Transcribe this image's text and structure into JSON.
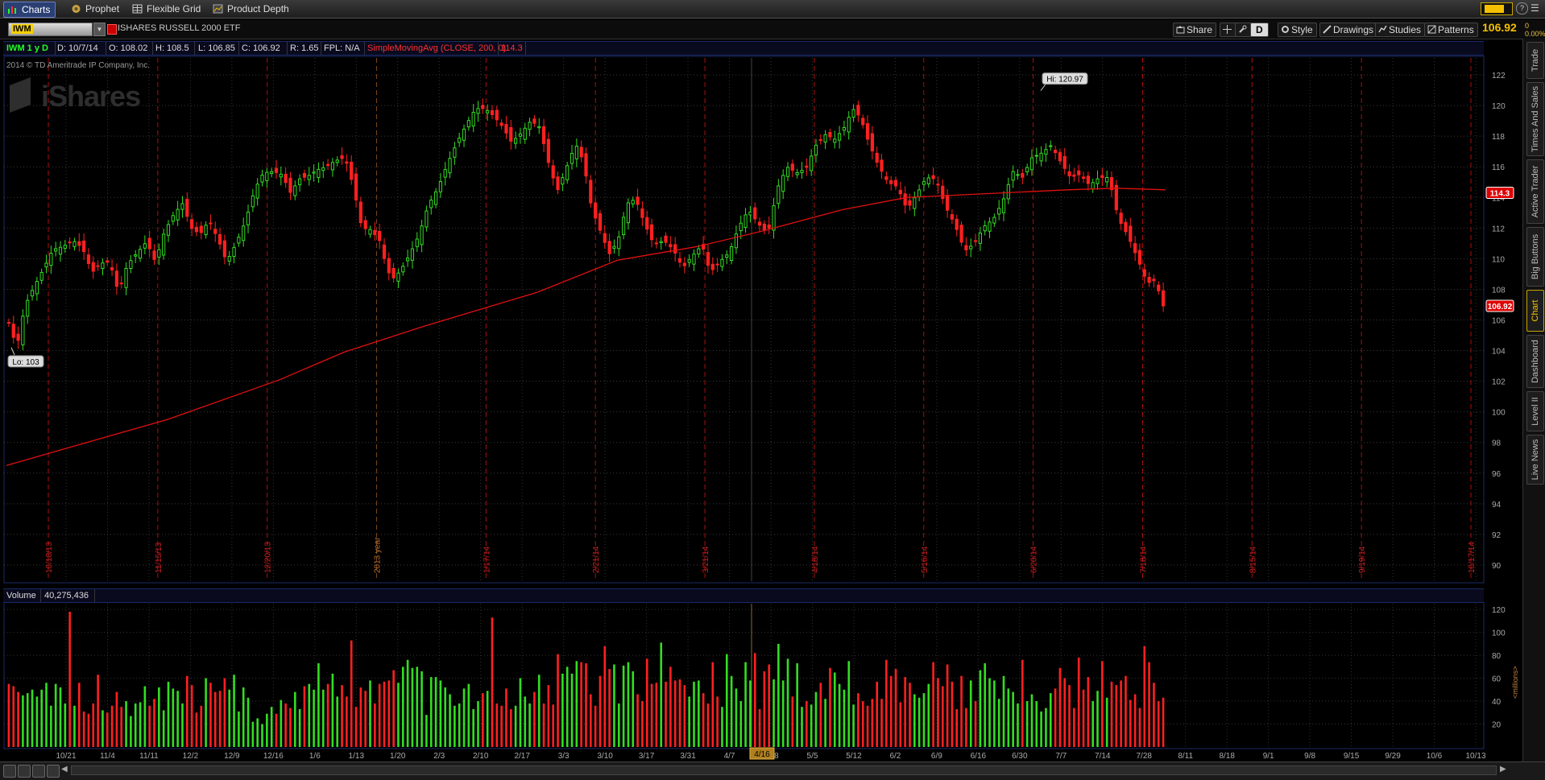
{
  "topbar": {
    "tabs": [
      {
        "label": "Charts",
        "icon": "charts-icon",
        "active": true
      },
      {
        "label": "Prophet",
        "icon": "prophet-icon",
        "active": false
      },
      {
        "label": "Flexible Grid",
        "icon": "grid-icon",
        "active": false
      },
      {
        "label": "Product Depth",
        "icon": "depth-icon",
        "active": false
      }
    ]
  },
  "header": {
    "symbol": "IWM",
    "name": "ISHARES RUSSELL 2000 ETF",
    "last_price": "106.92",
    "change_a": "0",
    "change_b": "0.00%"
  },
  "toolbar": {
    "share": "Share",
    "period": "D",
    "style": "Style",
    "drawings": "Drawings",
    "studies": "Studies",
    "patterns": "Patterns"
  },
  "ohlc": {
    "period": "IWM 1 y D",
    "date": "D: 10/7/14",
    "open": "O: 108.02",
    "high": "H: 108.5",
    "low": "L: 106.85",
    "close": "C: 106.92",
    "range": "R: 1.65",
    "fpl": "FPL: N/A",
    "study": "SimpleMovingAvg (CLOSE, 200, 0)",
    "study_value": "114.3"
  },
  "watermark": {
    "copyright": "2014 © TD Ameritrade IP Company, Inc.",
    "logo": "iShares"
  },
  "volume": {
    "label": "Volume",
    "value": "40,275,436",
    "unit_label": "<millions>"
  },
  "sidebar": {
    "tabs": [
      "Trade",
      "Times And Sales",
      "Active Trader",
      "Big Buttons",
      "Chart",
      "Dashboard",
      "Level II",
      "Live News"
    ],
    "active": "Chart"
  },
  "colors": {
    "up": "#33dd22",
    "down": "#ff2020",
    "sma": "#e01010",
    "price_tag": "#dd0000",
    "accent": "#f5c000"
  },
  "chart_data": [
    {
      "type": "candlestick",
      "title": "",
      "xlabel": "",
      "ylabel": "",
      "ylim": [
        89,
        123
      ],
      "yticks": [
        90,
        92,
        94,
        96,
        98,
        100,
        102,
        104,
        106,
        108,
        110,
        112,
        114,
        116,
        118,
        120,
        122
      ],
      "x_tick_labels": [
        "10/21",
        "11/4",
        "11/11",
        "12/2",
        "12/9",
        "12/16",
        "1/6",
        "1/13",
        "1/20",
        "2/3",
        "2/10",
        "2/17",
        "3/3",
        "3/10",
        "3/17",
        "3/31",
        "4/7",
        "4/28",
        "5/5",
        "5/12",
        "6/2",
        "6/9",
        "6/16",
        "6/30",
        "7/7",
        "7/14",
        "7/28",
        "8/11",
        "8/18",
        "9/1",
        "9/8",
        "9/15",
        "9/29",
        "10/6",
        "10/13"
      ],
      "event_labels": [
        "10/18/13",
        "11/15/13",
        "12/20/13",
        "2013 year",
        "1/17/14",
        "2/21/14",
        "3/21/14",
        "4/18/14",
        "5/16/14",
        "6/20/14",
        "7/18/14",
        "8/15/14",
        "9/19/14",
        "10/17/14"
      ],
      "cursor_label": "4/16",
      "hi_label": "Hi: 120.97",
      "lo_label": "Lo: 103",
      "sma_label": "114.3",
      "last_label": "106.92",
      "series": [
        {
          "name": "SimpleMovingAvg (CLOSE, 200, 0)",
          "points": [
            [
              0,
              96.5
            ],
            [
              80,
              97.7
            ],
            [
              200,
              99.5
            ],
            [
              340,
              102.1
            ],
            [
              420,
              103.9
            ],
            [
              520,
              105.6
            ],
            [
              660,
              107.8
            ],
            [
              760,
              109.9
            ],
            [
              860,
              110.8
            ],
            [
              940,
              111.8
            ],
            [
              1040,
              113.2
            ],
            [
              1120,
              114.0
            ],
            [
              1200,
              114.2
            ],
            [
              1320,
              114.5
            ],
            [
              1380,
              114.6
            ],
            [
              1442,
              114.5
            ]
          ]
        }
      ],
      "ohlc_path": [
        [
          0,
          105.8
        ],
        [
          10,
          104.2
        ],
        [
          20,
          106.9
        ],
        [
          30,
          108.0
        ],
        [
          45,
          109.5
        ],
        [
          55,
          110.6
        ],
        [
          68,
          110.8
        ],
        [
          80,
          111.2
        ],
        [
          92,
          110.7
        ],
        [
          104,
          109.1
        ],
        [
          115,
          109.7
        ],
        [
          126,
          109.8
        ],
        [
          137,
          107.8
        ],
        [
          148,
          109.6
        ],
        [
          159,
          110.3
        ],
        [
          172,
          111.1
        ],
        [
          183,
          109.8
        ],
        [
          194,
          111.7
        ],
        [
          206,
          112.9
        ],
        [
          217,
          113.6
        ],
        [
          228,
          112.0
        ],
        [
          239,
          111.6
        ],
        [
          250,
          112.5
        ],
        [
          262,
          111.2
        ],
        [
          272,
          109.8
        ],
        [
          284,
          111.0
        ],
        [
          296,
          112.5
        ],
        [
          307,
          114.5
        ],
        [
          318,
          115.6
        ],
        [
          330,
          115.7
        ],
        [
          341,
          115.5
        ],
        [
          352,
          114.3
        ],
        [
          363,
          115.2
        ],
        [
          374,
          115.4
        ],
        [
          385,
          115.8
        ],
        [
          396,
          116.0
        ],
        [
          408,
          116.4
        ],
        [
          420,
          116.6
        ],
        [
          430,
          114.8
        ],
        [
          441,
          112.0
        ],
        [
          452,
          111.9
        ],
        [
          463,
          111.2
        ],
        [
          470,
          109.8
        ],
        [
          478,
          108.6
        ],
        [
          489,
          109.2
        ],
        [
          500,
          110.2
        ],
        [
          512,
          111.5
        ],
        [
          524,
          113.5
        ],
        [
          536,
          114.6
        ],
        [
          548,
          116.2
        ],
        [
          560,
          117.6
        ],
        [
          572,
          118.8
        ],
        [
          583,
          119.8
        ],
        [
          595,
          119.8
        ],
        [
          606,
          119.3
        ],
        [
          617,
          118.6
        ],
        [
          628,
          117.6
        ],
        [
          640,
          118.2
        ],
        [
          652,
          119.0
        ],
        [
          663,
          118.6
        ],
        [
          674,
          116.3
        ],
        [
          685,
          114.4
        ],
        [
          697,
          116.0
        ],
        [
          708,
          117.5
        ],
        [
          718,
          116.3
        ],
        [
          728,
          113.3
        ],
        [
          739,
          111.8
        ],
        [
          750,
          110.3
        ],
        [
          761,
          111.2
        ],
        [
          772,
          113.6
        ],
        [
          783,
          113.9
        ],
        [
          794,
          112.3
        ],
        [
          806,
          110.9
        ],
        [
          818,
          111.2
        ],
        [
          830,
          110.6
        ],
        [
          842,
          109.4
        ],
        [
          854,
          110.2
        ],
        [
          866,
          110.9
        ],
        [
          876,
          109.1
        ],
        [
          888,
          109.8
        ],
        [
          900,
          110.4
        ],
        [
          912,
          112.1
        ],
        [
          924,
          113.2
        ],
        [
          936,
          112.3
        ],
        [
          948,
          111.6
        ],
        [
          960,
          114.6
        ],
        [
          972,
          116.0
        ],
        [
          984,
          115.6
        ],
        [
          996,
          115.9
        ],
        [
          1008,
          117.4
        ],
        [
          1020,
          118.1
        ],
        [
          1032,
          117.8
        ],
        [
          1044,
          118.6
        ],
        [
          1054,
          119.8
        ],
        [
          1064,
          119.2
        ],
        [
          1074,
          117.6
        ],
        [
          1086,
          116.1
        ],
        [
          1098,
          115.0
        ],
        [
          1110,
          114.7
        ],
        [
          1122,
          113.2
        ],
        [
          1134,
          114.2
        ],
        [
          1146,
          115.3
        ],
        [
          1158,
          115.2
        ],
        [
          1170,
          113.4
        ],
        [
          1182,
          112.2
        ],
        [
          1194,
          110.5
        ],
        [
          1206,
          111.0
        ],
        [
          1218,
          112.1
        ],
        [
          1230,
          112.6
        ],
        [
          1242,
          113.8
        ],
        [
          1254,
          115.7
        ],
        [
          1266,
          115.3
        ],
        [
          1278,
          116.6
        ],
        [
          1290,
          116.9
        ],
        [
          1302,
          117.4
        ],
        [
          1314,
          116.3
        ],
        [
          1326,
          115.3
        ],
        [
          1338,
          115.5
        ],
        [
          1350,
          114.8
        ],
        [
          1362,
          115.3
        ],
        [
          1374,
          115.3
        ],
        [
          1386,
          112.6
        ],
        [
          1398,
          111.5
        ],
        [
          1410,
          110.0
        ],
        [
          1422,
          108.4
        ],
        [
          1432,
          108.6
        ],
        [
          1442,
          106.92
        ]
      ],
      "volumes": [
        55,
        53,
        48,
        45,
        47,
        50,
        44,
        50,
        56,
        36,
        55,
        52,
        38,
        118,
        36,
        56,
        31,
        29,
        38,
        63,
        32,
        30,
        36,
        48,
        35,
        40,
        27,
        38,
        39,
        53,
        36,
        42,
        52,
        32,
        57,
        51,
        49,
        38,
        62,
        54,
        30,
        36,
        60,
        56,
        48,
        49,
        60,
        50,
        63,
        31,
        52,
        43,
        22,
        25,
        20,
        29,
        35,
        29,
        41,
        38,
        34,
        48,
        33,
        53,
        55,
        50,
        73,
        50,
        55,
        64,
        44,
        54,
        44,
        93,
        35,
        52,
        49,
        58,
        38,
        55,
        57,
        58,
        67,
        56,
        70,
        76,
        69,
        70,
        66,
        28,
        61,
        61,
        58,
        52,
        46,
        36,
        38,
        51,
        55,
        33,
        40,
        47,
        49,
        113,
        38,
        36,
        51,
        33,
        36,
        60,
        44,
        38,
        48,
        63,
        38,
        54,
        37,
        81,
        64,
        70,
        64,
        75,
        74,
        73,
        46,
        36,
        62,
        88,
        68,
        72,
        38,
        71,
        74,
        66,
        46,
        40,
        77,
        55,
        56,
        91,
        57,
        70,
        58,
        59,
        54,
        44,
        57,
        58,
        47,
        38,
        74,
        44,
        35,
        81,
        62,
        51,
        40,
        74,
        58,
        82,
        33,
        66,
        72,
        59,
        90,
        58,
        77,
        44,
        73,
        35,
        40,
        37,
        48,
        56,
        42,
        69,
        65,
        55,
        50,
        75,
        37,
        47,
        40,
        36,
        42,
        57,
        42,
        76,
        62,
        68,
        39,
        61,
        56,
        46,
        43,
        47,
        55,
        74,
        60,
        53,
        72,
        57,
        33,
        62,
        34,
        58,
        40,
        67,
        73,
        60,
        58,
        42,
        62,
        51,
        48,
        38,
        76,
        40,
        46,
        40,
        31,
        34,
        47,
        51,
        69,
        60,
        54,
        34,
        78,
        50,
        61,
        40,
        49,
        75,
        43,
        57,
        54,
        58,
        62,
        41,
        46,
        34,
        88,
        74,
        56,
        40,
        43
      ],
      "volume_ylim": [
        0,
        125
      ],
      "volume_yticks": [
        20,
        40,
        60,
        80,
        100,
        120
      ]
    }
  ]
}
